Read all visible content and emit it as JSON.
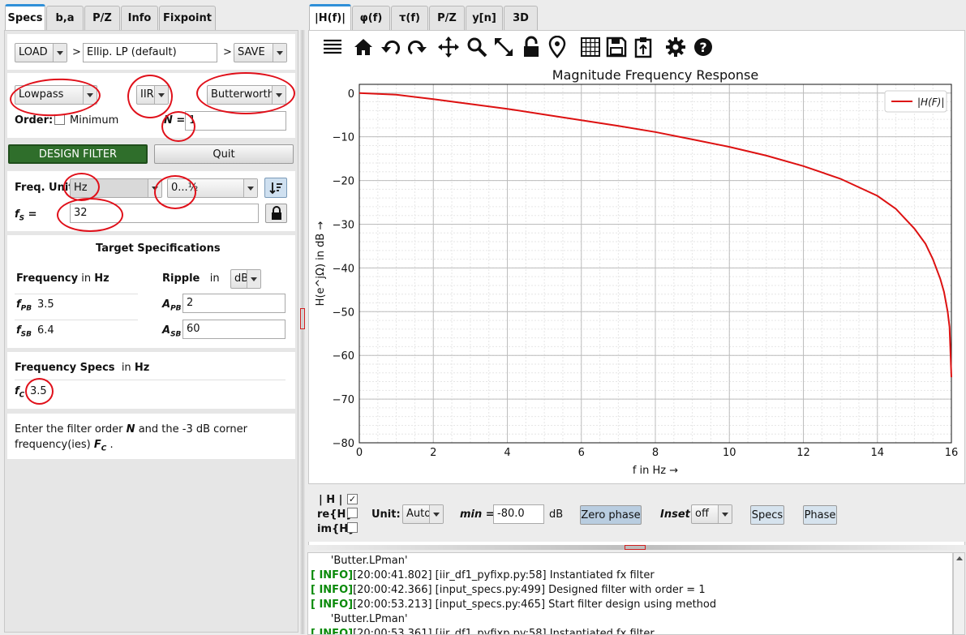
{
  "left_tabs": [
    "Specs",
    "b,a",
    "P/Z",
    "Info",
    "Fixpoint"
  ],
  "right_tabs": [
    "|H(f)|",
    "φ(f)",
    "τ(f)",
    "P/Z",
    "y[n]",
    "3D"
  ],
  "load": {
    "load_label": "LOAD",
    "arrow": ">",
    "filter_name": "Ellip. LP (default)",
    "arrow2": ">",
    "save_label": "SAVE"
  },
  "filter_type": {
    "response": "Lowpass",
    "kind": "IIR",
    "method": "Butterworth",
    "order_label": "Order:",
    "minimum_label": "Minimum",
    "n_label": "N =",
    "n_value": "1"
  },
  "actions": {
    "design_label": "DESIGN FILTER",
    "quit_label": "Quit"
  },
  "freq_unit": {
    "label": "Freq. Unit",
    "unit": "Hz",
    "range": "0...½",
    "fs_label": "f",
    "fs_sub": "S",
    "fs_eq": " =",
    "fs_value": "32"
  },
  "target": {
    "title": "Target Specifications",
    "freq_label": "Frequency",
    "freq_in": "in",
    "freq_unit": "Hz",
    "ripple_label": "Ripple",
    "ripple_in": "in",
    "ripple_unit": "dB",
    "fpb_label": "f",
    "fpb_sub": "PB",
    "fpb_value": "3.5",
    "fsb_label": "f",
    "fsb_sub": "SB",
    "fsb_value": "6.4",
    "apb_label": "A",
    "apb_sub": "PB",
    "apb_value": "2",
    "asb_label": "A",
    "asb_sub": "SB",
    "asb_value": "60"
  },
  "freq_specs": {
    "title": "Frequency Specs",
    "in": "in",
    "unit": "Hz",
    "fc_label": "f",
    "fc_sub": "C",
    "fc_value": "3.5"
  },
  "info_text": {
    "part1": "Enter the filter order ",
    "n": "N",
    "part2": " and the -3 dB corner frequency(ies) ",
    "fc": "F",
    "fc_sub": "C",
    "part3": "  ."
  },
  "toolbar_icons": [
    "menu-icon",
    "home-icon",
    "undo-icon",
    "redo-icon",
    "pan-icon",
    "zoom-icon",
    "fit-icon",
    "lock-icon",
    "marker-icon",
    "grid-icon",
    "save-icon",
    "clipboard-icon",
    "settings-icon",
    "help-icon"
  ],
  "plot_controls": {
    "h_label": "| H |",
    "re_label": "re{H}",
    "im_label": "im{H}",
    "unit_label": "Unit:",
    "unit_value": "Auto",
    "min_label": "min =",
    "min_value": "-80.0",
    "db_label": "dB",
    "zero_phase": "Zero phase",
    "inset_label": "Inset",
    "inset_value": "off",
    "specs_btn": "Specs",
    "phase_btn": "Phase"
  },
  "log": [
    {
      "tag": "",
      "text": "      'Butter.LPman'"
    },
    {
      "tag": "[ INFO]",
      "text": "[20:00:41.802] [iir_df1_pyfixp.py:58] Instantiated fx filter"
    },
    {
      "tag": "[ INFO]",
      "text": "[20:00:42.366] [input_specs.py:499] Designed filter with order = 1"
    },
    {
      "tag": "[ INFO]",
      "text": "[20:00:53.213] [input_specs.py:465] Start filter design using method"
    },
    {
      "tag": "",
      "text": "      'Butter.LPman'"
    },
    {
      "tag": "[ INFO]",
      "text": "[20:00:53.361] [iir_df1_pyfixp.py:58] Instantiated fx filter"
    }
  ],
  "chart_data": {
    "type": "line",
    "title": "Magnitude Frequency Response",
    "xlabel": "f in Hz →",
    "ylabel": "H(e^jΩ) in dB →",
    "xlim": [
      0,
      16
    ],
    "ylim": [
      -80,
      2
    ],
    "xticks": [
      0,
      2,
      4,
      6,
      8,
      10,
      12,
      14,
      16
    ],
    "yticks": [
      0,
      -10,
      -20,
      -30,
      -40,
      -50,
      -60,
      -70,
      -80
    ],
    "grid": true,
    "legend_position": "top-right",
    "series": [
      {
        "name": "|H(F)|",
        "color": "#dd1111",
        "x": [
          0,
          1,
          2,
          3,
          4,
          5,
          6,
          7,
          8,
          9,
          10,
          11,
          12,
          13,
          14,
          14.5,
          15,
          15.3,
          15.5,
          15.7,
          15.8,
          15.9,
          15.95,
          16
        ],
        "y": [
          0,
          -0.35,
          -1.4,
          -2.5,
          -3.6,
          -4.9,
          -6.2,
          -7.5,
          -8.9,
          -10.6,
          -12.3,
          -14.3,
          -16.7,
          -19.6,
          -23.5,
          -26.5,
          -31,
          -34.5,
          -38,
          -42.5,
          -45.5,
          -50,
          -53.5,
          -65
        ]
      }
    ]
  }
}
